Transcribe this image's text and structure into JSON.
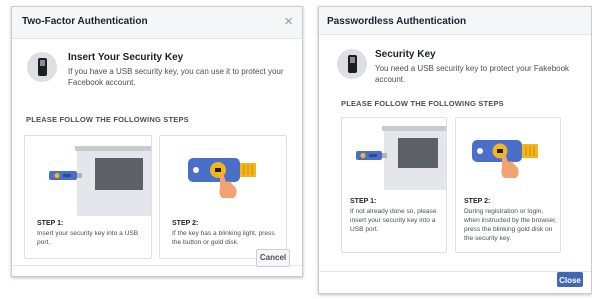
{
  "left_dialog": {
    "title": "Two-Factor Authentication",
    "close_glyph": "×",
    "section_title": "Insert Your Security Key",
    "section_desc": "If you have a USB security key, you can use it to protect your Facebook account.",
    "steps_heading": "PLEASE FOLLOW THE FOLLOWING STEPS",
    "step1": {
      "label": "STEP 1:",
      "desc": "Insert your security key into a USB port."
    },
    "step2": {
      "label": "STEP 2:",
      "desc": "If the key has a blinking light, press the button or gold disk."
    },
    "cancel_label": "Cancel"
  },
  "right_dialog": {
    "title": "Passwordless Authentication",
    "section_title": "Security Key",
    "section_desc": "You need a USB security key to protect your Fakebook account.",
    "steps_heading": "PLEASE FOLLOW THE FOLLOWING STEPS",
    "step1": {
      "label": "STEP 1:",
      "desc": "If not already done so, please insert your security key into a USB port."
    },
    "step2": {
      "label": "STEP 2:",
      "desc": "During registration or login, when instructed by the browser, press the blinking gold disk on the security key."
    },
    "close_label": "Close"
  },
  "icons": [
    "usb-key-icon",
    "laptop-usb-illustration",
    "key-press-illustration",
    "close-icon"
  ],
  "colors": {
    "primary": "#4267b2",
    "key_blue": "#4a6fc9",
    "gold": "#f5b51c",
    "hand": "#f2a373",
    "header_bg": "#f5f6f7"
  }
}
